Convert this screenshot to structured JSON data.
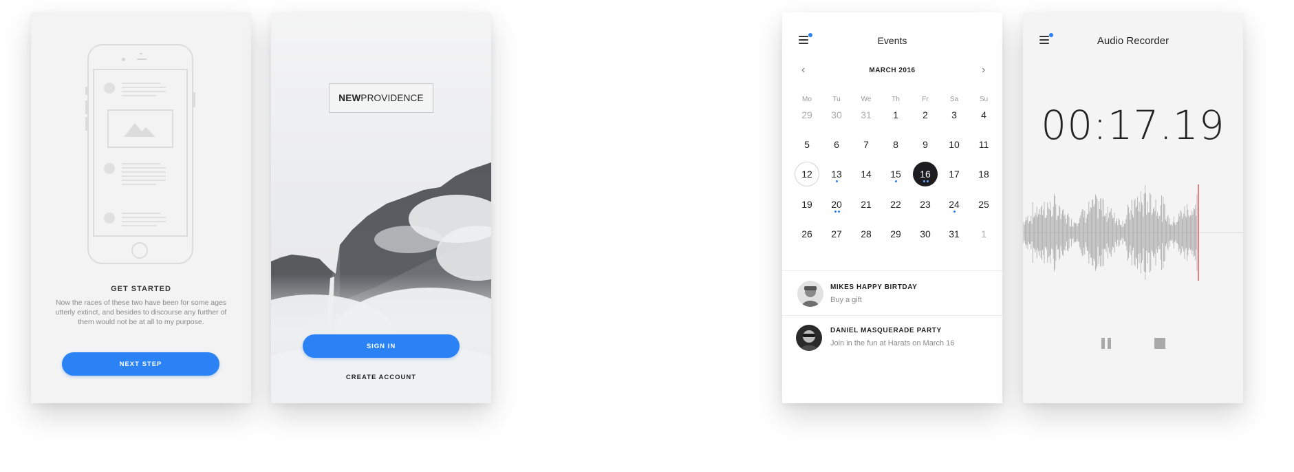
{
  "onboarding": {
    "title": "GET STARTED",
    "body": "Now the races of these two have been for some ages utterly extinct, and besides to discourse any further of them would not be at all to my purpose.",
    "button": "NEXT STEP"
  },
  "login": {
    "logo_bold": "NEW",
    "logo_rest": "PROVIDENCE",
    "signin": "SIGN IN",
    "create": "CREATE ACCOUNT"
  },
  "events": {
    "title": "Events",
    "month": "MARCH 2016",
    "weekdays": [
      "Mo",
      "Tu",
      "We",
      "Th",
      "Fr",
      "Sa",
      "Su"
    ],
    "weeks": [
      [
        "29",
        "30",
        "31",
        "1",
        "2",
        "3",
        "4"
      ],
      [
        "5",
        "6",
        "7",
        "8",
        "9",
        "10",
        "11"
      ],
      [
        "12",
        "13",
        "14",
        "15",
        "16",
        "17",
        "18"
      ],
      [
        "19",
        "20",
        "21",
        "22",
        "23",
        "24",
        "25"
      ],
      [
        "26",
        "27",
        "28",
        "29",
        "30",
        "31",
        "1"
      ]
    ],
    "list": [
      {
        "title": "MIKES HAPPY BIRTDAY",
        "subtitle": "Buy a gift"
      },
      {
        "title": "DANIEL MASQUERADE PARTY",
        "subtitle": "Join in the fun at Harats on March 16"
      }
    ]
  },
  "recorder": {
    "title": "Audio Recorder",
    "time": "00:17.19"
  },
  "colors": {
    "accent": "#2b82f5",
    "selected": "#1d1d1f",
    "playhead": "#e0302f"
  }
}
